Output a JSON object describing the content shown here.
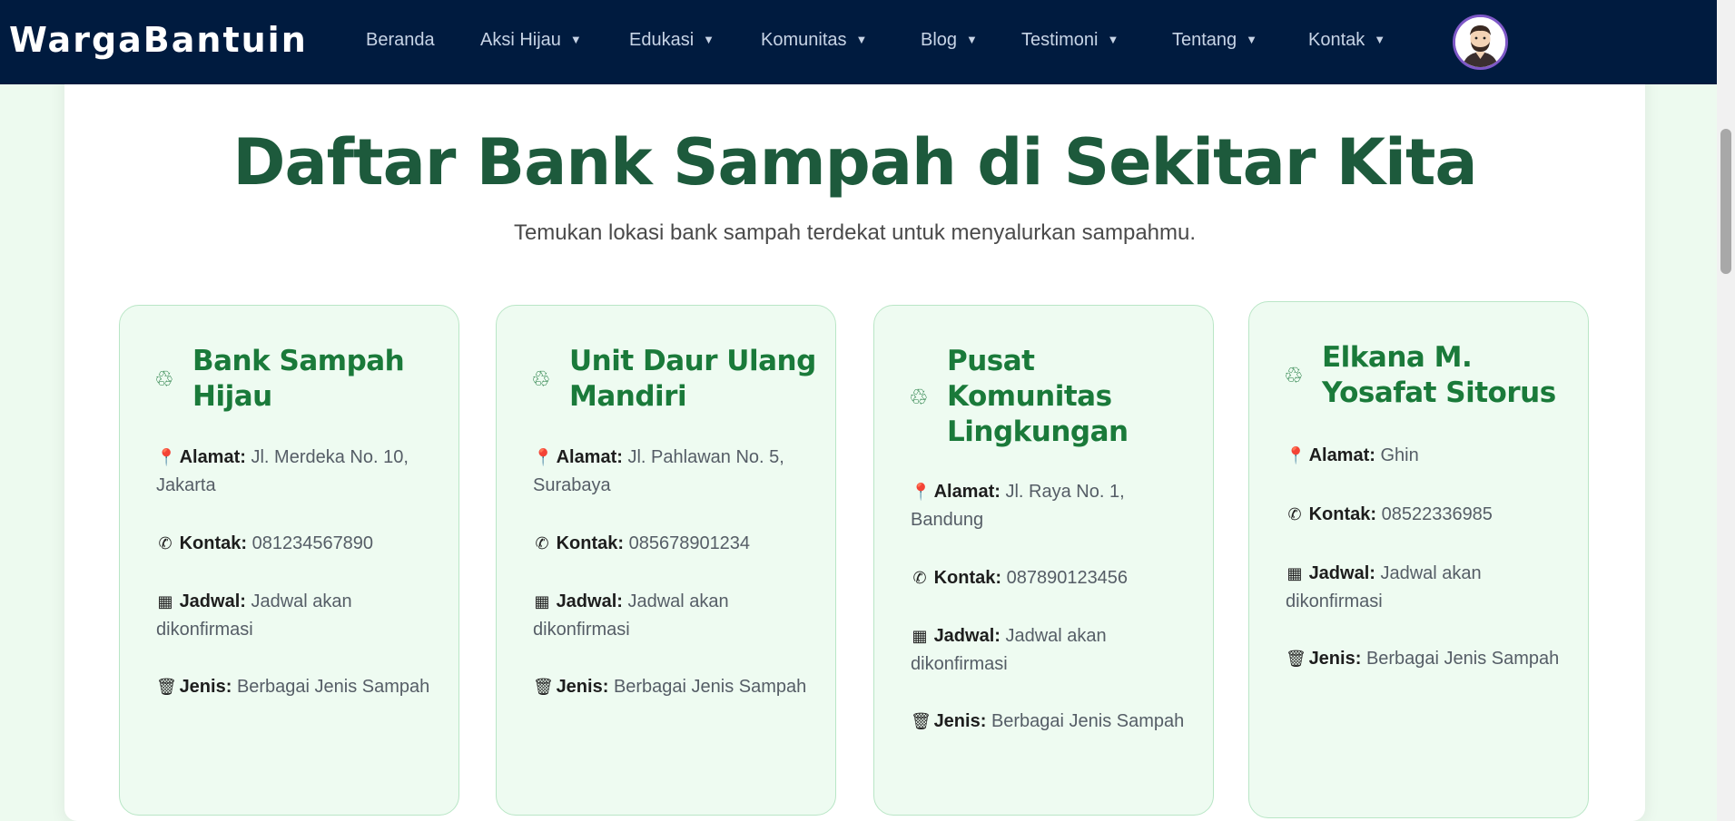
{
  "navbar": {
    "brand": "WargaBantuin",
    "items": [
      {
        "label": "Beranda",
        "caret": ""
      },
      {
        "label": "Aksi Hijau",
        "caret": "▼"
      },
      {
        "label": "Edukasi",
        "caret": "▼"
      },
      {
        "label": "Komunitas",
        "caret": "▼"
      },
      {
        "label": "Blog",
        "caret": "▼"
      },
      {
        "label": "Testimoni",
        "caret": "▼"
      },
      {
        "label": "Tentang",
        "caret": "▼"
      },
      {
        "label": "Kontak",
        "caret": "▼"
      }
    ],
    "avatar_icon": "user-avatar"
  },
  "main": {
    "title": "Daftar Bank Sampah di Sekitar Kita",
    "subtitle": "Temukan lokasi bank sampah terdekat untuk menyalurkan sampahmu."
  },
  "labels": {
    "alamat": "Alamat:",
    "kontak": "Kontak:",
    "jadwal": "Jadwal:",
    "jenis": "Jenis:"
  },
  "icons": {
    "recycle": "♲",
    "location": "📍",
    "phone": "✆",
    "calendar": "▦",
    "trash": "🗑"
  },
  "cards": [
    {
      "title": "Bank Sampah Hijau",
      "alamat": "Jl. Merdeka No. 10, Jakarta",
      "kontak": "081234567890",
      "jadwal": "Jadwal akan dikonfirmasi",
      "jenis": "Berbagai Jenis Sampah"
    },
    {
      "title": "Unit Daur Ulang Mandiri",
      "alamat": "Jl. Pahlawan No. 5, Surabaya",
      "kontak": "085678901234",
      "jadwal": "Jadwal akan dikonfirmasi",
      "jenis": "Berbagai Jenis Sampah"
    },
    {
      "title": "Pusat Komunitas Lingkungan",
      "alamat": "Jl. Raya No. 1, Bandung",
      "kontak": "087890123456",
      "jadwal": "Jadwal akan dikonfirmasi",
      "jenis": "Berbagai Jenis Sampah"
    },
    {
      "title": "Elkana M. Yosafat Sitorus",
      "alamat": "Ghin",
      "kontak": "08522336985",
      "jadwal": "Jadwal akan dikonfirmasi",
      "jenis": "Berbagai Jenis Sampah"
    }
  ],
  "colors": {
    "navbar_bg": "#001b3f",
    "title_green": "#1d5a3c",
    "card_title_green": "#1a7a3a",
    "card_bg": "#eefbf1",
    "card_border": "#b9e6c6",
    "avatar_ring": "#7e58c7"
  }
}
